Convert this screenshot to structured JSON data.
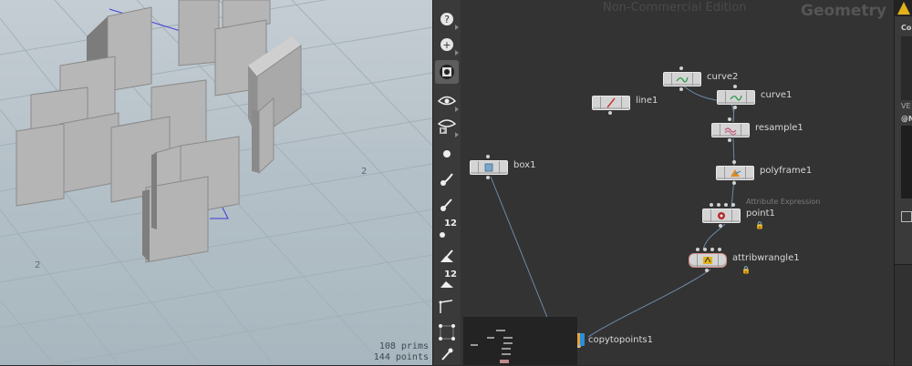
{
  "viewport": {
    "stats_prims": "108  prims",
    "stats_points": "144 points"
  },
  "toolbar": {
    "tools": [
      {
        "name": "light-icon",
        "num": ""
      },
      {
        "name": "add-light-icon",
        "num": ""
      },
      {
        "name": "display-icon",
        "num": ""
      },
      {
        "name": "visibility-eye-icon",
        "num": ""
      },
      {
        "name": "render-eye-icon",
        "num": ""
      },
      {
        "name": "point-icon",
        "num": ""
      },
      {
        "name": "normal-icon",
        "num": ""
      },
      {
        "name": "point-normal-icon",
        "num": ""
      },
      {
        "name": "point-number-icon",
        "num": "12"
      },
      {
        "name": "prim-normal-icon",
        "num": ""
      },
      {
        "name": "prim-number-icon",
        "num": "12"
      },
      {
        "name": "uv-edge-icon",
        "num": ""
      },
      {
        "name": "snap-grid-icon",
        "num": ""
      },
      {
        "name": "pose-icon",
        "num": ""
      }
    ]
  },
  "network": {
    "watermark": "Non-Commercial Edition",
    "context": "Geometry",
    "nodes": [
      {
        "id": "curve2",
        "label": "curve2",
        "sub": ""
      },
      {
        "id": "curve1",
        "label": "curve1",
        "sub": ""
      },
      {
        "id": "line1",
        "label": "line1",
        "sub": ""
      },
      {
        "id": "resample1",
        "label": "resample1",
        "sub": ""
      },
      {
        "id": "box1",
        "label": "box1",
        "sub": ""
      },
      {
        "id": "polyframe1",
        "label": "polyframe1",
        "sub": ""
      },
      {
        "id": "point1",
        "label": "point1",
        "sub": "Attribute Expression"
      },
      {
        "id": "attribwrangle1",
        "label": "attribwrangle1",
        "sub": ""
      },
      {
        "id": "copytopoints1",
        "label": "copytopoints1",
        "sub": ""
      }
    ]
  },
  "right_panel": {
    "top_label": "Co",
    "section_label": "VE",
    "code_fragment": "@N"
  },
  "colors": {
    "viewport_sky": "#c5cdd4",
    "network_bg": "#333333",
    "node_fill": "#d4d4d4",
    "display_flag": "#2a8fd8"
  }
}
